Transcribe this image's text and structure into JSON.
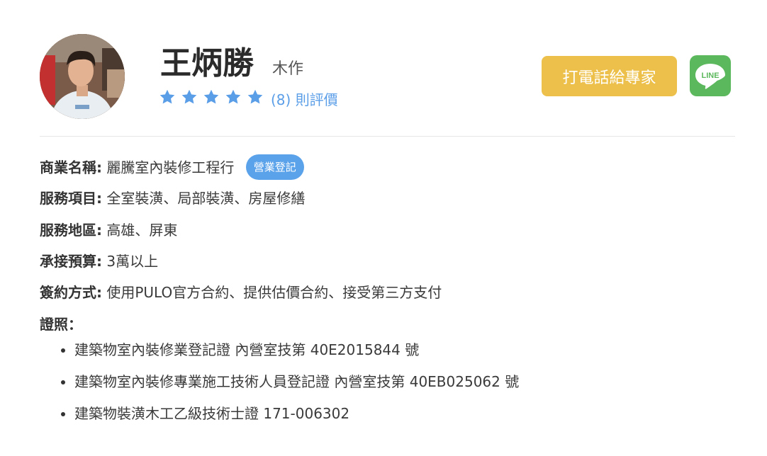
{
  "profile": {
    "name": "王炳勝",
    "trade": "木作",
    "rating_stars": 5,
    "rating_count": "(8) 則評價"
  },
  "actions": {
    "call_label": "打電話給專家",
    "line_label": "LINE"
  },
  "details": {
    "business_name": {
      "label": "商業名稱:",
      "value": "麗騰室內裝修工程行",
      "badge": "營業登記"
    },
    "services": {
      "label": "服務項目:",
      "value": "全室裝潢、局部裝潢、房屋修繕"
    },
    "area": {
      "label": "服務地區:",
      "value": "高雄、屏東"
    },
    "budget": {
      "label": "承接預算:",
      "value": "3萬以上"
    },
    "contract": {
      "label": "簽約方式:",
      "value": "使用PULO官方合約、提供估價合約、接受第三方支付"
    },
    "licenses_label": "證照："
  },
  "licenses": [
    "建築物室內裝修業登記證 內營室技第 40E2015844 號",
    "建築物室內裝修專業施工技術人員登記證 內營室技第 40EB025062 號",
    "建築物裝潢木工乙級技術士證 171-006302"
  ],
  "colors": {
    "star": "#5b9ee8",
    "call_button": "#ecc04a",
    "line_button": "#5cb85c",
    "badge": "#5aa2ea"
  },
  "icons": {
    "star": "star-icon",
    "line": "line-logo-icon"
  }
}
